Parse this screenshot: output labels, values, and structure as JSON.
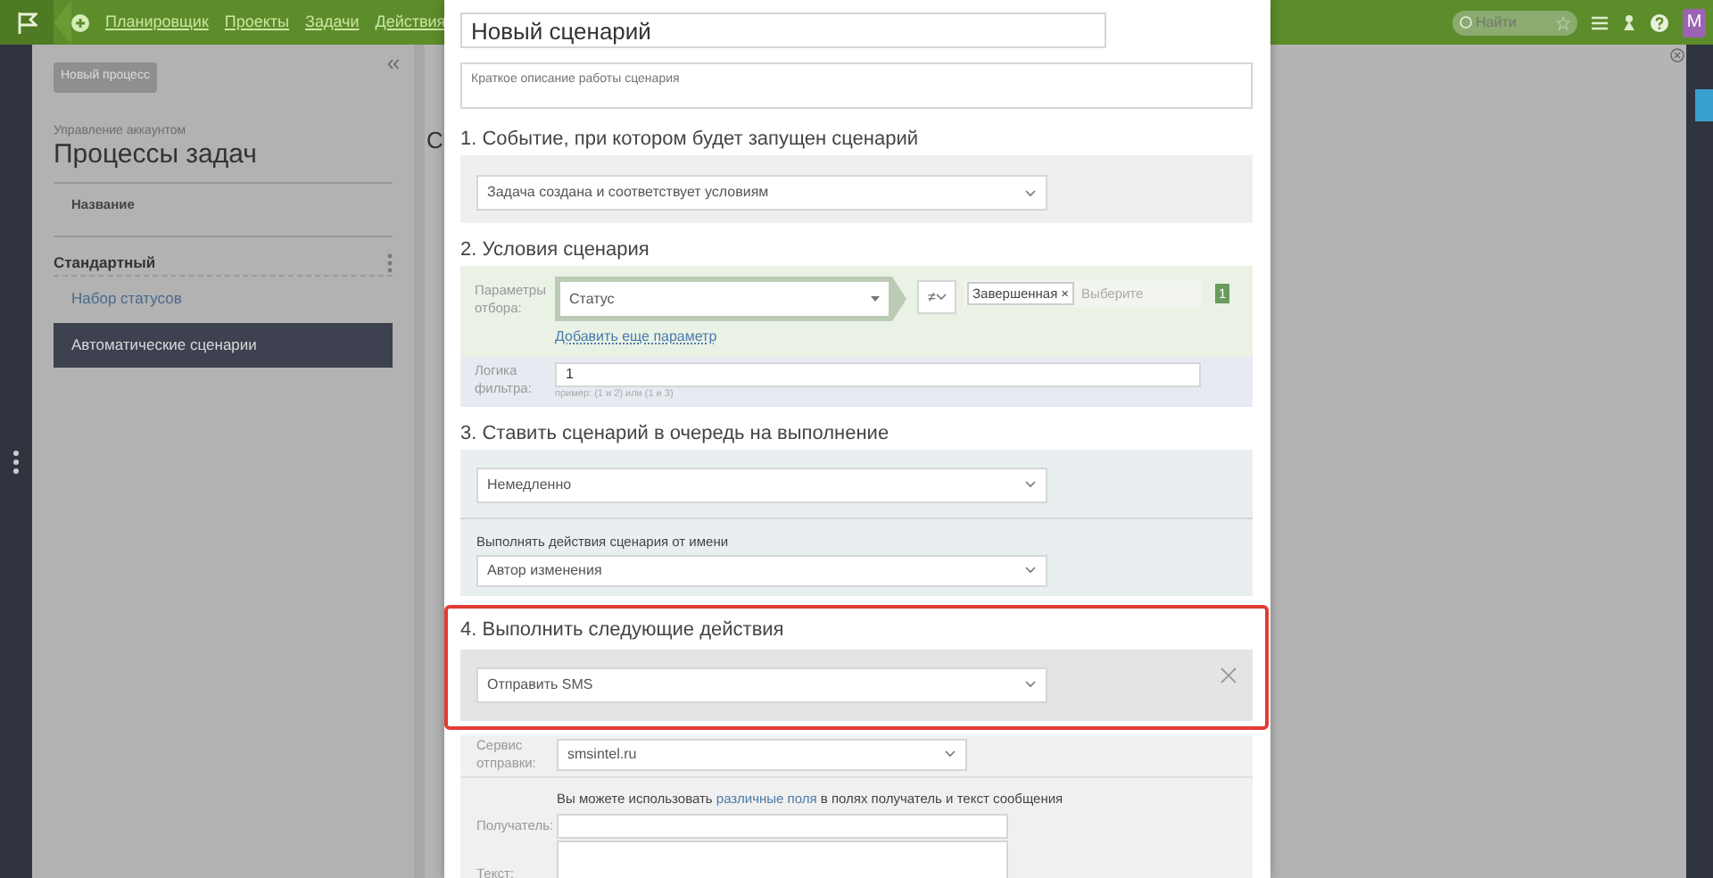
{
  "nav": {
    "items": [
      "Планировщик",
      "Проекты",
      "Задачи",
      "Действия"
    ],
    "search": {
      "placeholder": "Найти"
    },
    "avatar": "M"
  },
  "sidebar": {
    "new_button": "Новый процесс",
    "breadcrumb": "Управление аккаунтом",
    "title": "Процессы задач",
    "column_header": "Название",
    "group": "Стандартный",
    "items": [
      {
        "label": "Набор статусов",
        "selected": false
      },
      {
        "label": "Автоматические сценарии",
        "selected": true
      }
    ]
  },
  "content": {
    "title": "С"
  },
  "modal": {
    "name": {
      "value": "Новый сценарий"
    },
    "description": {
      "placeholder": "Краткое описание работы сценария"
    },
    "sections": [
      {
        "kind": "event",
        "title": "1. Событие, при котором будет запущен сценарий",
        "highlighted": false,
        "select": "Задача создана и соответствует условиям"
      },
      {
        "kind": "conditions",
        "title": "2. Условия сценария",
        "highlighted": false,
        "param_label": "Параметры отбора:",
        "param": "Статус",
        "operator": "≠",
        "tags": [
          "Завершенная"
        ],
        "tag_remove": "×",
        "placeholder": "Выберите",
        "count": "1",
        "add_link": "Добавить еще параметр",
        "logic_label": "Логика фильтра:",
        "logic_value": "1",
        "logic_hint": "пример: (1 и 2) или (1 и 3)"
      },
      {
        "kind": "queue",
        "title": "3. Ставить сценарий в очередь на выполнение",
        "highlighted": false,
        "select": "Немедленно",
        "actor_label": "Выполнять действия сценария от имени",
        "actor": "Автор изменения"
      },
      {
        "kind": "actions",
        "title": "4. Выполнить следующие действия",
        "highlighted": true,
        "select": "Отправить SMS",
        "service_label": "Сервис отправки:",
        "service": "smsintel.ru",
        "info_before": "Вы можете использовать",
        "info_link": "различные поля",
        "info_after": "в полях получатель и текст сообщения",
        "recipient_label": "Получатель:",
        "text_label": "Текст:"
      }
    ]
  }
}
